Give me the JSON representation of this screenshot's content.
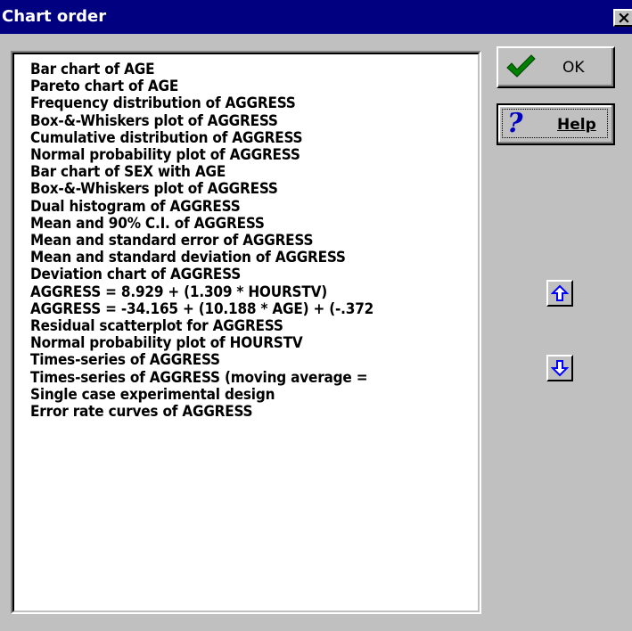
{
  "window": {
    "title": "Chart order",
    "close_label": "×"
  },
  "buttons": {
    "ok_label": "OK",
    "help_label": "Help"
  },
  "icons": {
    "ok": "checkmark-icon",
    "help": "question-mark-icon",
    "move_up": "arrow-up-icon",
    "move_down": "arrow-down-icon"
  },
  "colors": {
    "titlebar": "#000080",
    "face": "#c0c0c0",
    "check": "#008000",
    "arrow": "#0000ff"
  },
  "chart_list": [
    "Bar chart of AGE",
    "Pareto chart of AGE",
    "Frequency distribution of AGGRESS",
    "Box-&-Whiskers plot of AGGRESS",
    "Cumulative distribution of AGGRESS",
    "Normal probability plot of AGGRESS",
    "Bar chart of SEX with AGE",
    "Box-&-Whiskers plot of AGGRESS",
    "Dual histogram of AGGRESS",
    "Mean and 90% C.I. of AGGRESS",
    "Mean and standard error of AGGRESS",
    "Mean and standard deviation of AGGRESS",
    "Deviation chart of AGGRESS",
    "AGGRESS = 8.929 + (1.309 * HOURSTV)",
    "AGGRESS = -34.165 + (10.188 * AGE) + (-.372",
    "Residual scatterplot for AGGRESS",
    "Normal probability plot of HOURSTV",
    "Times-series of AGGRESS",
    "Times-series of AGGRESS (moving average =",
    "Single case experimental design",
    "Error rate curves of AGGRESS"
  ]
}
